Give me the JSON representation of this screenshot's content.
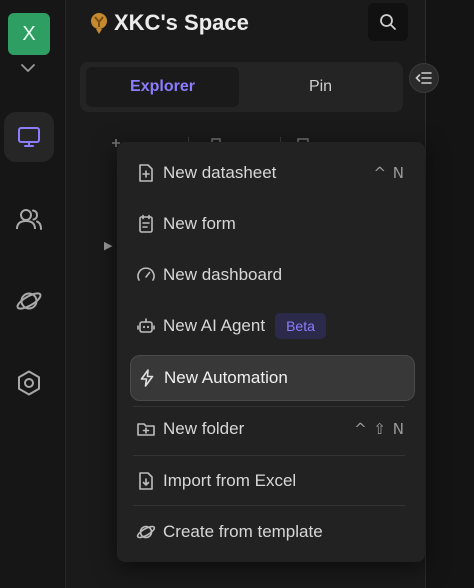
{
  "workspace": {
    "initial": "X"
  },
  "space": {
    "title": "XKC's Space"
  },
  "tabs": [
    {
      "label": "Explorer",
      "active": true
    },
    {
      "label": "Pin",
      "active": false
    }
  ],
  "rail": {
    "items": [
      {
        "icon": "monitor-icon",
        "active": true
      },
      {
        "icon": "users-icon",
        "active": false
      },
      {
        "icon": "planet-icon",
        "active": false
      },
      {
        "icon": "settings-hexagon-icon",
        "active": false
      }
    ]
  },
  "menu": {
    "items": [
      {
        "icon": "datasheet-plus-icon",
        "label": "New datasheet",
        "shortcut": "^ N"
      },
      {
        "icon": "form-icon",
        "label": "New form"
      },
      {
        "icon": "dashboard-gauge-icon",
        "label": "New dashboard"
      },
      {
        "icon": "robot-icon",
        "label": "New AI Agent",
        "badge": "Beta"
      },
      {
        "icon": "lightning-icon",
        "label": "New Automation",
        "hovered": true
      },
      {
        "icon": "folder-plus-icon",
        "label": "New folder",
        "shortcut": "^ ⇧ N"
      },
      {
        "icon": "import-file-icon",
        "label": "Import from Excel"
      },
      {
        "icon": "template-planet-icon",
        "label": "Create from template"
      }
    ]
  },
  "colors": {
    "accent": "#8c7dff",
    "workspace_avatar": "#2f9e63",
    "menu_bg": "#222222"
  }
}
